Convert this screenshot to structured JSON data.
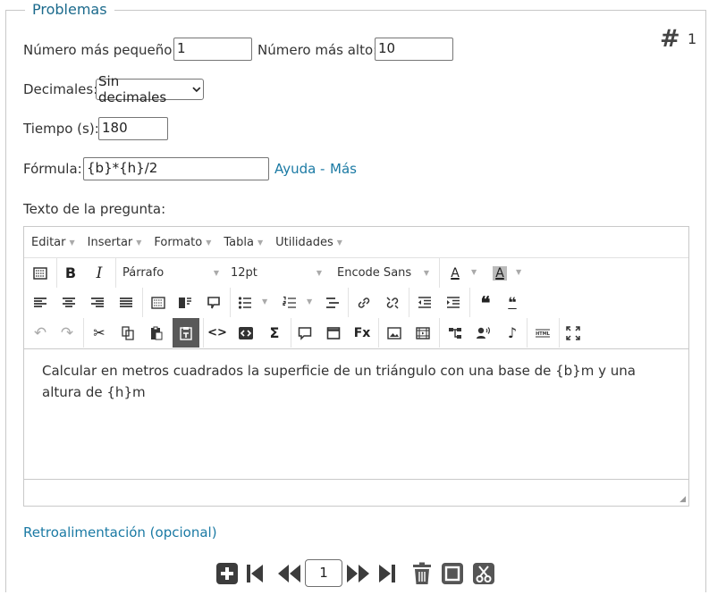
{
  "section": {
    "legend": "Problemas",
    "hash_icon": "#",
    "item_number": "1"
  },
  "fields": {
    "min_label": "Número más pequeño:",
    "min_value": "1",
    "max_label": "Número más alto:",
    "max_value": "10",
    "decimals_label": "Decimales:",
    "decimals_selected": "Sin decimales",
    "time_label": "Tiempo (s):",
    "time_value": "180",
    "formula_label": "Fórmula:",
    "formula_value": "{b}*{h}/2",
    "help_link": "Ayuda",
    "link_sep": "-",
    "more_link": "Más"
  },
  "question": {
    "label": "Texto de la pregunta:"
  },
  "editor": {
    "menus": [
      "Editar",
      "Insertar",
      "Formato",
      "Tabla",
      "Utilidades"
    ],
    "block_format": "Párrafo",
    "font_size": "12pt",
    "font_family": "Encode Sans",
    "bold": "B",
    "italic": "I",
    "text_color": "A",
    "bg_color": "A",
    "content": "Calcular en metros cuadrados la superficie de un triángulo con una base de {b}m y una altura de {h}m"
  },
  "feedback_link": "Retroalimentación (opcional)",
  "pager": {
    "page": "1"
  }
}
